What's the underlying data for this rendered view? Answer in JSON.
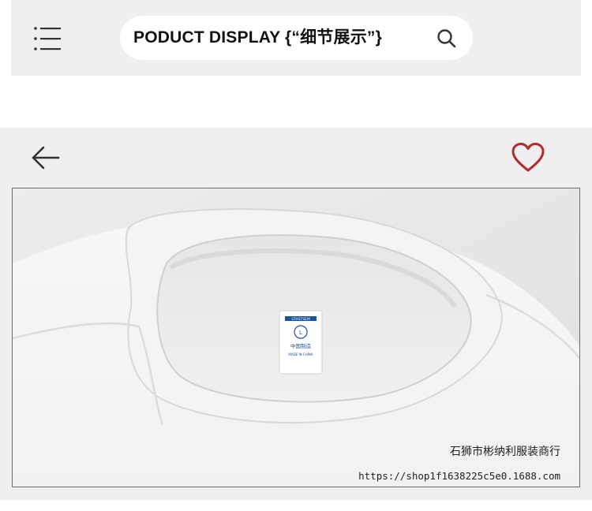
{
  "header": {
    "search_text": "PODUCT DISPLAY {“细节展示”}",
    "menu_icon": "hamburger-menu-icon",
    "search_icon": "magnifier-icon"
  },
  "detail": {
    "back_icon": "arrow-left-icon",
    "favorite_icon": "heart-outline-icon",
    "favorite_color": "#b52a2e"
  },
  "product_image": {
    "label_brand": "STASTSEM",
    "label_size": "L",
    "label_made_cn": "中国制造",
    "label_made_en": "MADE IN CHINA",
    "watermark_shop": "石狮市彬纳利服装商行",
    "watermark_url": "https://shop1f1638225c5e0.1688.com"
  }
}
